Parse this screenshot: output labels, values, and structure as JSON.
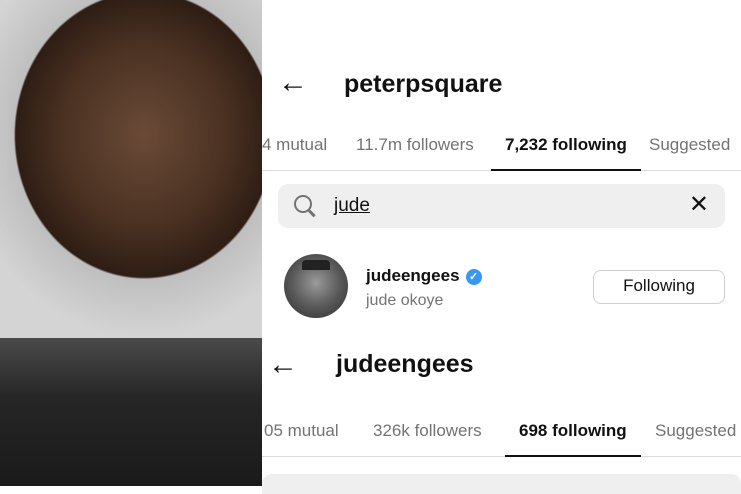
{
  "screens": [
    {
      "username": "peterpsquare",
      "tabs": [
        "4 mutual",
        "11.7m followers",
        "7,232 following",
        "Suggested"
      ],
      "search": {
        "value": "jude"
      },
      "result": {
        "username": "judeengees",
        "full_name": "jude okoye",
        "button_label": "Following",
        "verified": true
      }
    },
    {
      "username": "judeengees",
      "tabs": [
        "05 mutual",
        "326k followers",
        "698 following",
        "Suggested"
      ]
    }
  ],
  "icons": {
    "back": "←",
    "clear": "✕",
    "verified": "✓"
  },
  "colors": {
    "verified_blue": "#3897f0",
    "inactive_tab": "#737373",
    "active_tab": "#111111"
  }
}
